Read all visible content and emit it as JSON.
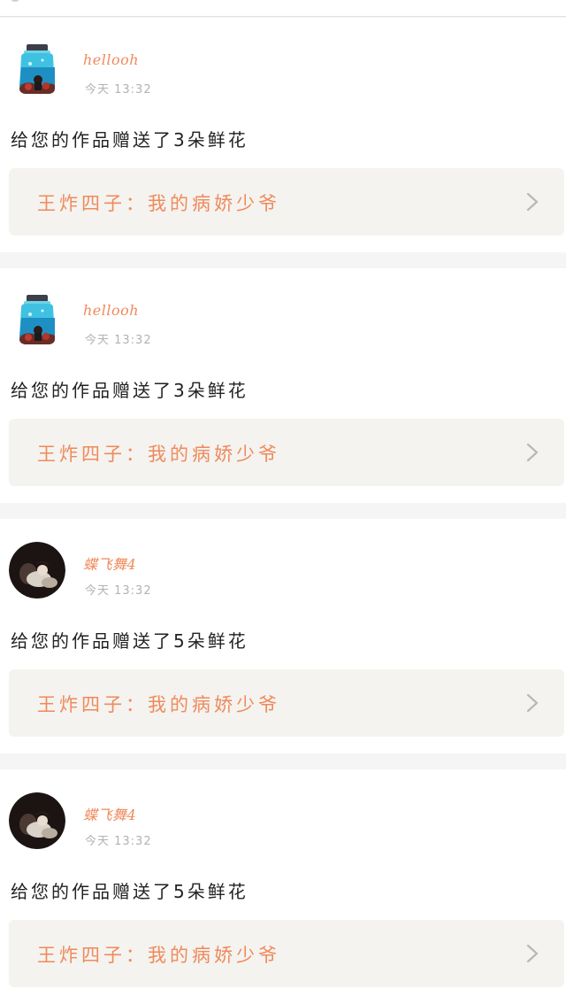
{
  "notifications": [
    {
      "username": "hellooh",
      "time": "今天 13:32",
      "message": "给您的作品赠送了3朵鲜花",
      "work_title": "王炸四子：我的病娇少爷",
      "avatar_icon": "jar-avatar-icon"
    },
    {
      "username": "hellooh",
      "time": "今天 13:32",
      "message": "给您的作品赠送了3朵鲜花",
      "work_title": "王炸四子：我的病娇少爷",
      "avatar_icon": "jar-avatar-icon"
    },
    {
      "username": "蝶飞舞4",
      "time": "今天 13:32",
      "message": "给您的作品赠送了5朵鲜花",
      "work_title": "王炸四子：我的病娇少爷",
      "avatar_icon": "dark-photo-avatar-icon"
    },
    {
      "username": "蝶飞舞4",
      "time": "今天 13:32",
      "message": "给您的作品赠送了5朵鲜花",
      "work_title": "王炸四子：我的病娇少爷",
      "avatar_icon": "dark-photo-avatar-icon"
    }
  ],
  "colors": {
    "accent": "#ef8a5c",
    "link_bg": "#f4f3ef",
    "page_bg": "#f5f5f5",
    "muted_text": "#b2b2b2"
  }
}
